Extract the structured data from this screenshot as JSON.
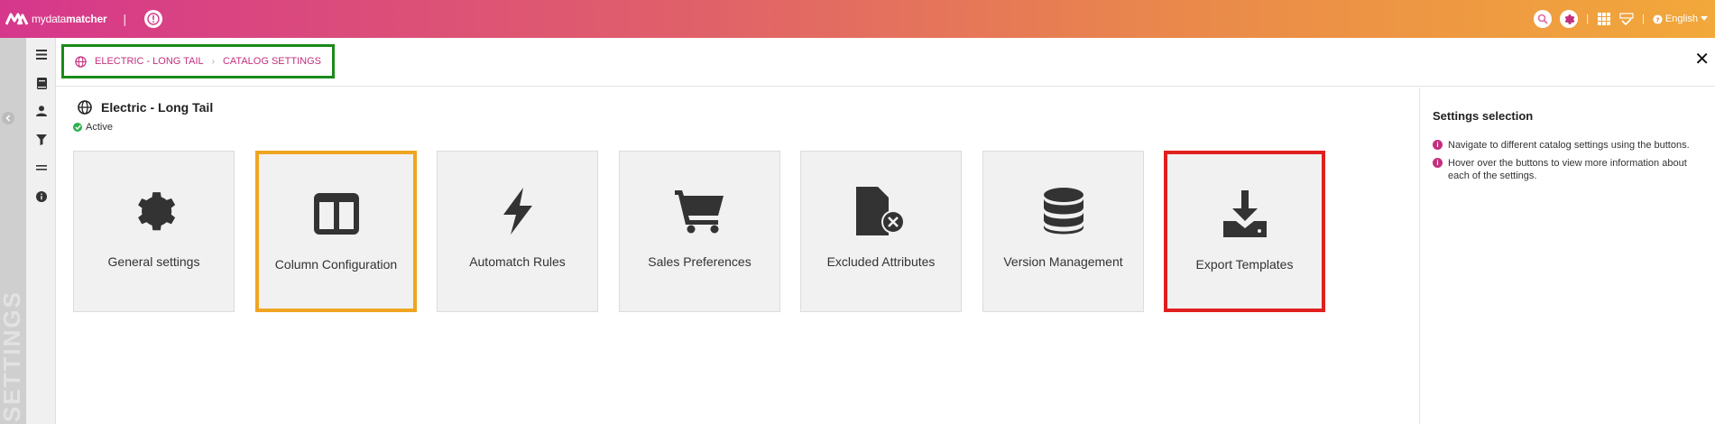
{
  "app": {
    "logo_brand_light": "mydata",
    "logo_brand_bold": "matcher",
    "language": "English"
  },
  "sidebar": {
    "vertical_label": "SETTINGS",
    "icons": [
      "menu-icon",
      "book-icon",
      "user-icon",
      "filter-icon",
      "list-icon",
      "info-icon"
    ]
  },
  "breadcrumb": {
    "items": [
      "ELECTRIC - LONG TAIL",
      "CATALOG SETTINGS"
    ],
    "separator": "›"
  },
  "catalog": {
    "title": "Electric - Long Tail",
    "status": "Active"
  },
  "tiles": [
    {
      "label": "General settings",
      "icon": "gear-icon"
    },
    {
      "label": "Column Configuration",
      "icon": "columns-icon",
      "highlight": "#f0a521"
    },
    {
      "label": "Automatch Rules",
      "icon": "bolt-icon"
    },
    {
      "label": "Sales Preferences",
      "icon": "cart-icon"
    },
    {
      "label": "Excluded Attributes",
      "icon": "file-x-icon"
    },
    {
      "label": "Version Management",
      "icon": "database-icon"
    },
    {
      "label": "Export Templates",
      "icon": "download-icon",
      "highlight": "#e0201e"
    }
  ],
  "right_panel": {
    "title": "Settings selection",
    "items": [
      "Navigate to different catalog settings using the buttons.",
      "Hover over the buttons to view more information about each of the settings."
    ]
  },
  "colors": {
    "accent": "#c2307e",
    "breadcrumb_outline": "#1a8a1a",
    "active_status": "#2bb24c",
    "tile_icon": "#333333"
  }
}
